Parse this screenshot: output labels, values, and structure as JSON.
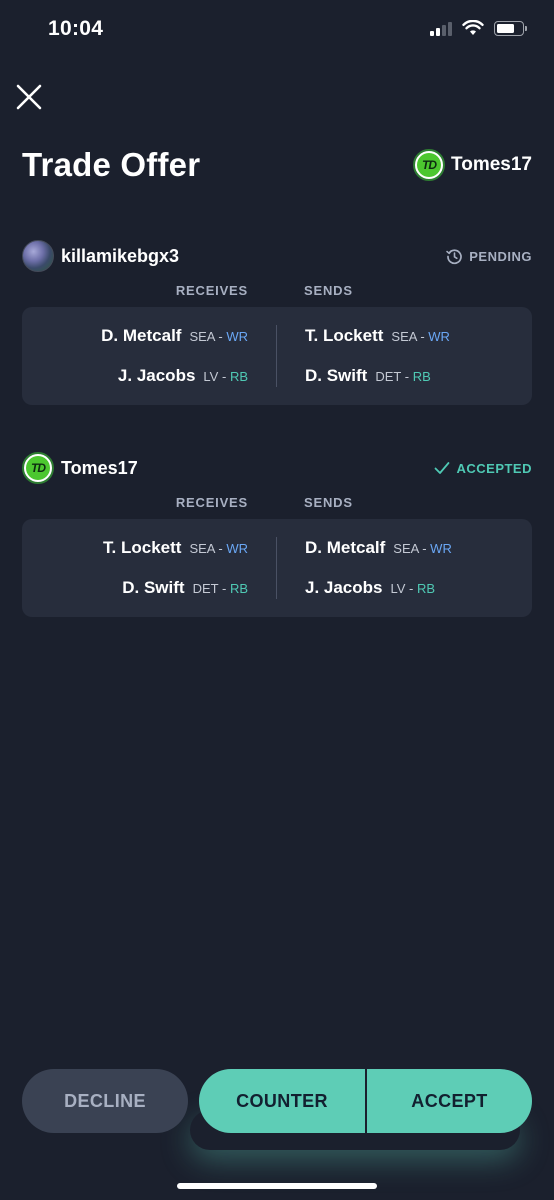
{
  "status_bar": {
    "time": "10:04"
  },
  "header": {
    "title": "Trade Offer",
    "username": "Tomes17",
    "logo_text": "TD"
  },
  "offers": [
    {
      "username": "killamikebgx3",
      "status": "PENDING",
      "receives_label": "RECEIVES",
      "sends_label": "SENDS",
      "receives": [
        {
          "name": "D. Metcalf",
          "team": "SEA -",
          "pos": "WR"
        },
        {
          "name": "J. Jacobs",
          "team": "LV -",
          "pos": "RB"
        }
      ],
      "sends": [
        {
          "name": "T. Lockett",
          "team": "SEA -",
          "pos": "WR"
        },
        {
          "name": "D. Swift",
          "team": "DET -",
          "pos": "RB"
        }
      ]
    },
    {
      "username": "Tomes17",
      "logo_text": "TD",
      "status": "ACCEPTED",
      "receives_label": "RECEIVES",
      "sends_label": "SENDS",
      "receives": [
        {
          "name": "T. Lockett",
          "team": "SEA -",
          "pos": "WR"
        },
        {
          "name": "D. Swift",
          "team": "DET -",
          "pos": "RB"
        }
      ],
      "sends": [
        {
          "name": "D. Metcalf",
          "team": "SEA -",
          "pos": "WR"
        },
        {
          "name": "J. Jacobs",
          "team": "LV -",
          "pos": "RB"
        }
      ]
    }
  ],
  "actions": {
    "decline": "DECLINE",
    "counter": "COUNTER",
    "accept": "ACCEPT"
  },
  "colors": {
    "background": "#1b202d",
    "card": "#272d3c",
    "accent": "#5ecdb6",
    "wr": "#6aa7f5",
    "rb": "#4fc9b4"
  }
}
